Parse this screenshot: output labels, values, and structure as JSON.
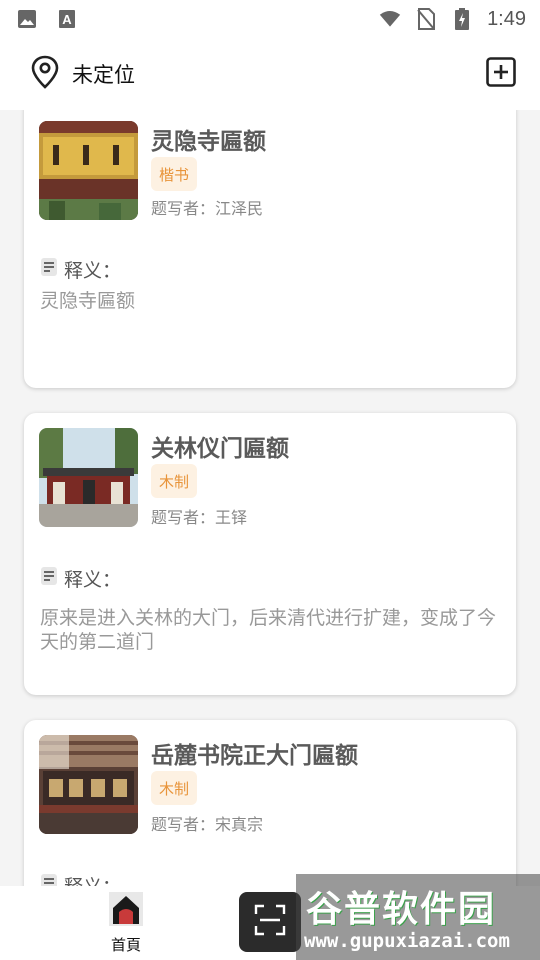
{
  "status_bar": {
    "time": "1:49",
    "icons": [
      "image-icon",
      "a-box-icon",
      "wifi-icon",
      "no-sim-icon",
      "battery-charging-icon"
    ]
  },
  "top_bar": {
    "location_text": "未定位",
    "icons": [
      "location-pin-icon",
      "add-square-icon"
    ]
  },
  "cards": [
    {
      "title": "灵隐寺匾额",
      "tag": "楷书",
      "writer": "题写者：江泽民",
      "meaning_label": "释义：",
      "meaning": "灵隐寺匾额"
    },
    {
      "title": "关林仪门匾额",
      "tag": "木制",
      "writer": "题写者：王铎",
      "meaning_label": "释义：",
      "meaning": "原来是进入关林的大门，后来清代进行扩建，变成了今天的第二道门"
    },
    {
      "title": "岳麓书院正大门匾额",
      "tag": "木制",
      "writer": "题写者：宋真宗",
      "meaning_label": "释义：",
      "meaning": ""
    }
  ],
  "bottom_nav": {
    "home_label": "首頁",
    "icons": [
      "home-icon",
      "scan-icon"
    ]
  },
  "watermark": {
    "title": "谷普软件园",
    "url": "www.gupuxiazai.com"
  },
  "colors": {
    "tag_text": "#e8943a",
    "tag_bg": "#fdf1e2",
    "scan_bg": "#2b2b2b"
  }
}
